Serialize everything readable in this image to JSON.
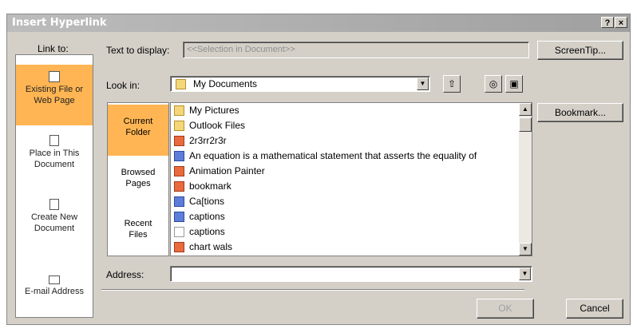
{
  "window": {
    "title": "Insert Hyperlink",
    "help_btn": "?",
    "close_btn": "×"
  },
  "link_to": {
    "label": "Link to:",
    "items": [
      {
        "label_line1": "Existing File or",
        "label_line2": "Web Page",
        "icon": "globe-page-icon"
      },
      {
        "label_line1": "Place in This",
        "label_line2": "Document",
        "icon": "document-place-icon"
      },
      {
        "label_line1": "Create New",
        "label_line2": "Document",
        "icon": "new-document-icon"
      },
      {
        "label_line1": "E-mail Address",
        "label_line2": "",
        "icon": "email-icon"
      }
    ]
  },
  "text_to_display": {
    "label": "Text to display:",
    "value": "<<Selection in Document>>"
  },
  "screentip_button": "ScreenTip...",
  "look_in": {
    "label": "Look in:",
    "value": "My Documents"
  },
  "nav": [
    {
      "line1": "Current",
      "line2": "Folder"
    },
    {
      "line1": "Browsed",
      "line2": "Pages"
    },
    {
      "line1": "Recent",
      "line2": "Files"
    }
  ],
  "files": [
    {
      "name": "My Pictures",
      "type": "folder"
    },
    {
      "name": "Outlook Files",
      "type": "folder"
    },
    {
      "name": "2r3rr2r3r",
      "type": "ppt"
    },
    {
      "name": "An equation is a mathematical statement that asserts the equality of",
      "type": "doc"
    },
    {
      "name": "Animation Painter",
      "type": "ppt"
    },
    {
      "name": "bookmark",
      "type": "ppt"
    },
    {
      "name": "Ca[tions",
      "type": "doc"
    },
    {
      "name": "captions",
      "type": "doc"
    },
    {
      "name": "captions",
      "type": "txt"
    },
    {
      "name": "chart wals",
      "type": "ppt"
    }
  ],
  "bookmark_button": "Bookmark...",
  "address": {
    "label": "Address:",
    "value": ""
  },
  "ok_button": "OK",
  "cancel_button": "Cancel"
}
